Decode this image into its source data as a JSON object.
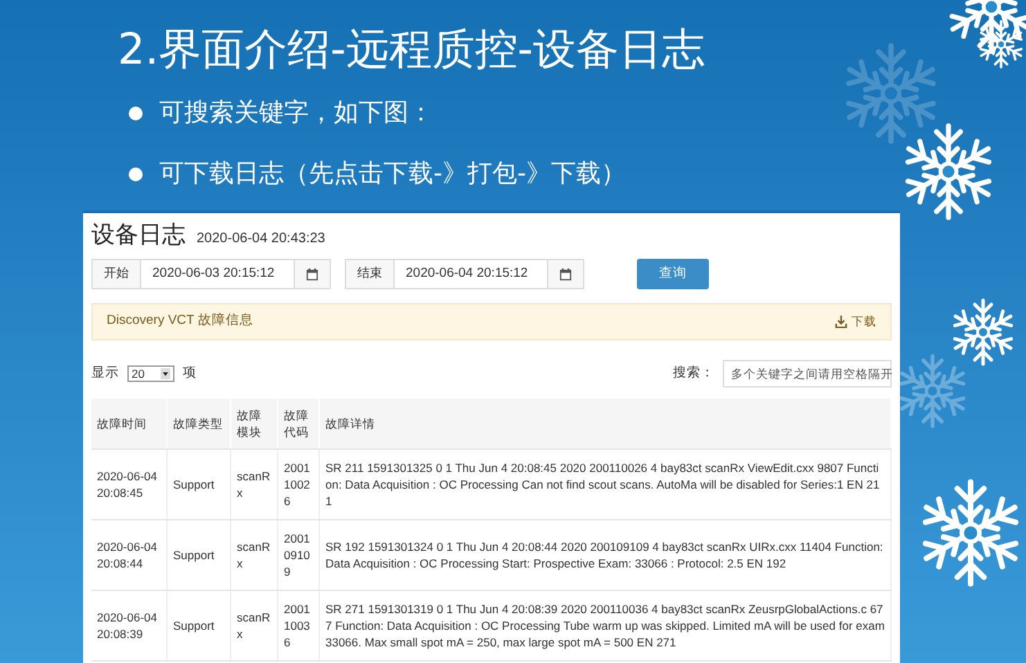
{
  "slide": {
    "title": "2.界面介绍-远程质控-设备日志",
    "bullets": [
      "可搜索关键字，如下图：",
      "可下载日志（先点击下载-》打包-》下载）"
    ]
  },
  "log_page": {
    "title": "设备日志",
    "timestamp": "2020-06-04 20:43:23",
    "start": {
      "label": "开始",
      "value": "2020-06-03 20:15:12"
    },
    "end": {
      "label": "结束",
      "value": "2020-06-04 20:15:12"
    },
    "query_button": "查询",
    "alert": {
      "text": "Discovery VCT 故障信息",
      "download": "下载"
    },
    "show_label": "显示",
    "page_size": "20",
    "items_label": "项",
    "search_label": "搜索：",
    "search_placeholder": "多个关键字之间请用空格隔开",
    "table": {
      "columns": [
        "故障时间",
        "故障类型",
        "故障模块",
        "故障代码",
        "故障详情"
      ],
      "rows": [
        [
          "2020-06-04 20:08:45",
          "Support",
          "scanRx",
          "200110026",
          "SR 211 1591301325 0 1 Thu Jun 4 20:08:45 2020 200110026 4 bay83ct scanRx ViewEdit.cxx 9807 Function: Data Acquisition : OC Processing Can not find scout scans. AutoMa will be disabled for Series:1 EN 211"
        ],
        [
          "2020-06-04 20:08:44",
          "Support",
          "scanRx",
          "200109109",
          "SR 192 1591301324 0 1 Thu Jun 4 20:08:44 2020 200109109 4 bay83ct scanRx UIRx.cxx 11404 Function: Data Acquisition : OC Processing Start: Prospective Exam: 33066 : Protocol: 2.5 EN 192"
        ],
        [
          "2020-06-04 20:08:39",
          "Support",
          "scanRx",
          "200110036",
          "SR 271 1591301319 0 1 Thu Jun 4 20:08:39 2020 200110036 4 bay83ct scanRx ZeusrpGlobalActions.c 677 Function: Data Acquisition : OC Processing Tube warm up was skipped. Limited mA will be used for exam 33066. Max small spot mA = 250, max large spot mA = 500 EN 271"
        ]
      ]
    }
  }
}
